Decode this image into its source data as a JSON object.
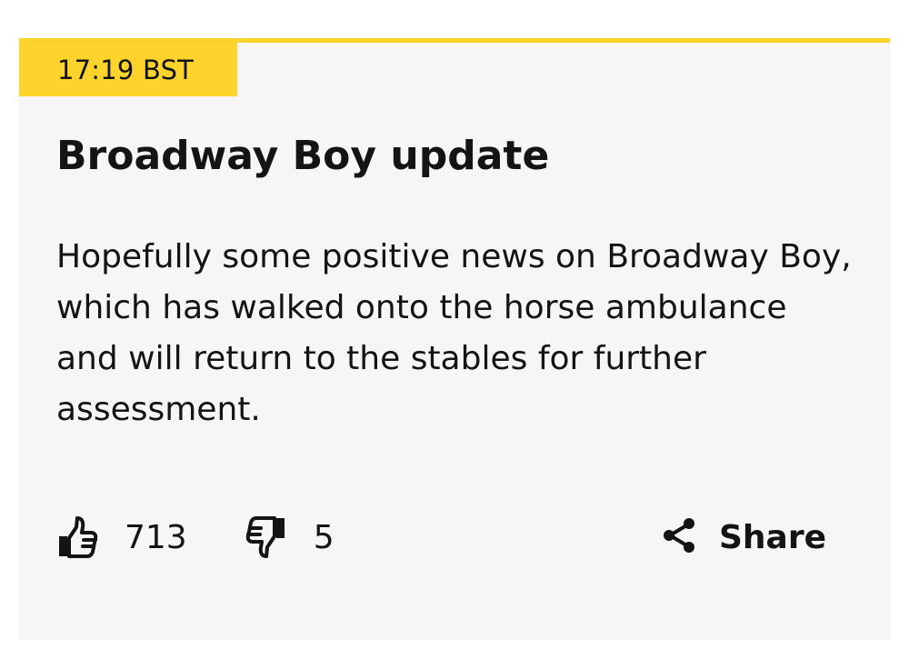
{
  "post": {
    "timestamp": "17:19 BST",
    "headline": "Broadway Boy update",
    "body": "Hopefully some positive news on Broadway Boy, which has walked onto the horse ambulance and will return to the stables for further assessment."
  },
  "reactions": {
    "likes": "713",
    "dislikes": "5",
    "like_icon": "thumbs-up-icon",
    "dislike_icon": "thumbs-down-icon"
  },
  "share": {
    "label": "Share",
    "icon": "share-icon"
  },
  "colors": {
    "accent": "#fdd32c",
    "card_background": "#f6f6f6",
    "text": "#141414"
  }
}
